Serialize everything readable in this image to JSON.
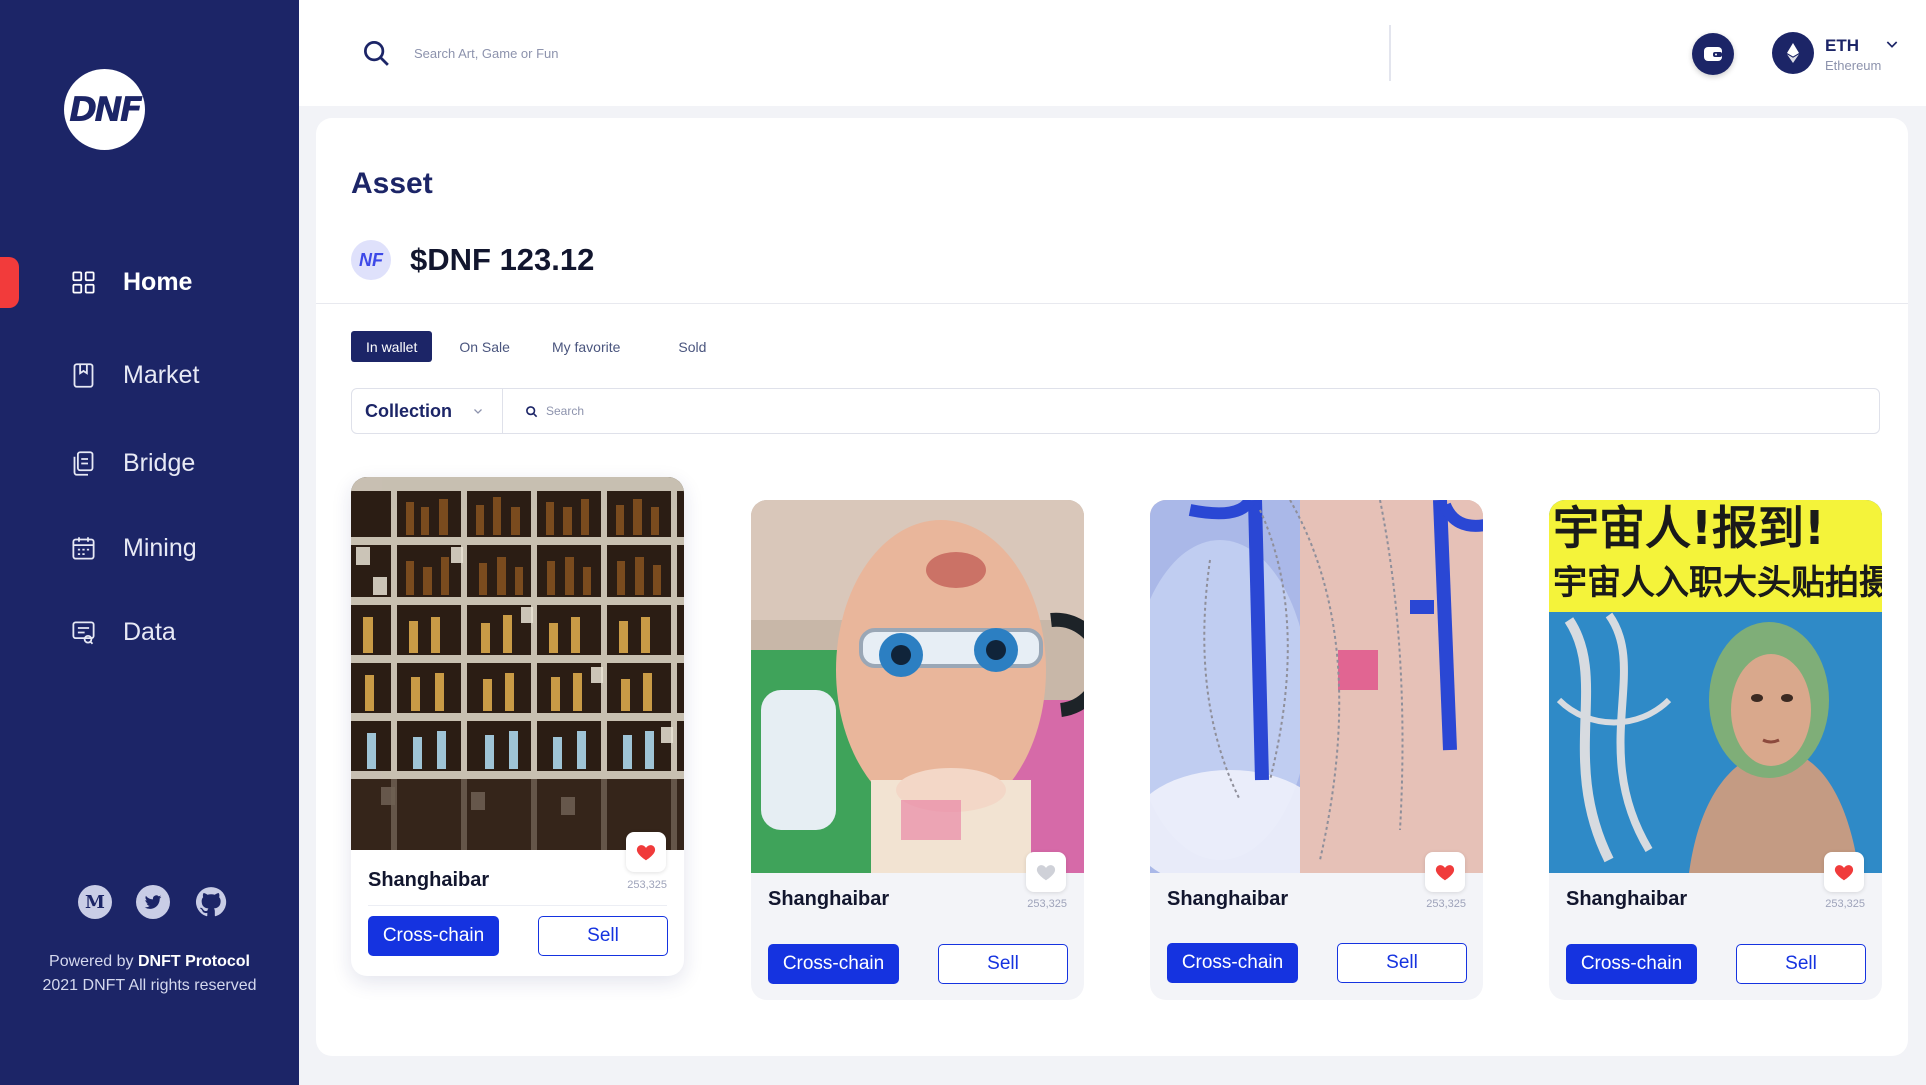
{
  "app": {
    "logo_text": "DNF"
  },
  "sidebar": {
    "items": [
      {
        "label": "Home",
        "icon": "grid-icon",
        "active": true
      },
      {
        "label": "Market",
        "icon": "bookmark-icon"
      },
      {
        "label": "Bridge",
        "icon": "documents-icon"
      },
      {
        "label": "Mining",
        "icon": "calendar-icon"
      },
      {
        "label": "Data",
        "icon": "report-icon"
      }
    ],
    "socials": [
      {
        "icon": "medium-icon",
        "glyph": "M"
      },
      {
        "icon": "twitter-icon"
      },
      {
        "icon": "github-icon"
      }
    ],
    "footer": {
      "powered_prefix": "Powered by",
      "powered_brand": "DNFT Protocol",
      "rights": "2021 DNFT All rights reserved"
    }
  },
  "header": {
    "search_placeholder": "Search Art, Game or Fun",
    "network": {
      "symbol": "ETH",
      "name": "Ethereum"
    }
  },
  "main": {
    "title": "Asset",
    "balance_icon_text": "NF",
    "balance": "$DNF 123.12",
    "tabs": [
      {
        "label": "In wallet",
        "active": true
      },
      {
        "label": "On Sale"
      },
      {
        "label": "My favorite"
      },
      {
        "label": "Sold"
      }
    ],
    "filter": {
      "collection_label": "Collection",
      "search_placeholder": "Search"
    },
    "cards": [
      {
        "name": "Shanghaibar",
        "count": "253,325",
        "liked": true,
        "cross_label": "Cross-chain",
        "sell_label": "Sell"
      },
      {
        "name": "Shanghaibar",
        "count": "253,325",
        "liked": false,
        "cross_label": "Cross-chain",
        "sell_label": "Sell"
      },
      {
        "name": "Shanghaibar",
        "count": "253,325",
        "liked": true,
        "cross_label": "Cross-chain",
        "sell_label": "Sell"
      },
      {
        "name": "Shanghaibar",
        "count": "253,325",
        "liked": true,
        "cross_label": "Cross-chain",
        "sell_label": "Sell",
        "poster_line1": "宇宙人!报到!",
        "poster_line2": "宇宙人入职大头贴拍摄"
      }
    ]
  },
  "colors": {
    "sidebar": "#1c2567",
    "accent": "#1533e0",
    "heart": "#f03b3b",
    "indicator": "#f23b3b"
  }
}
